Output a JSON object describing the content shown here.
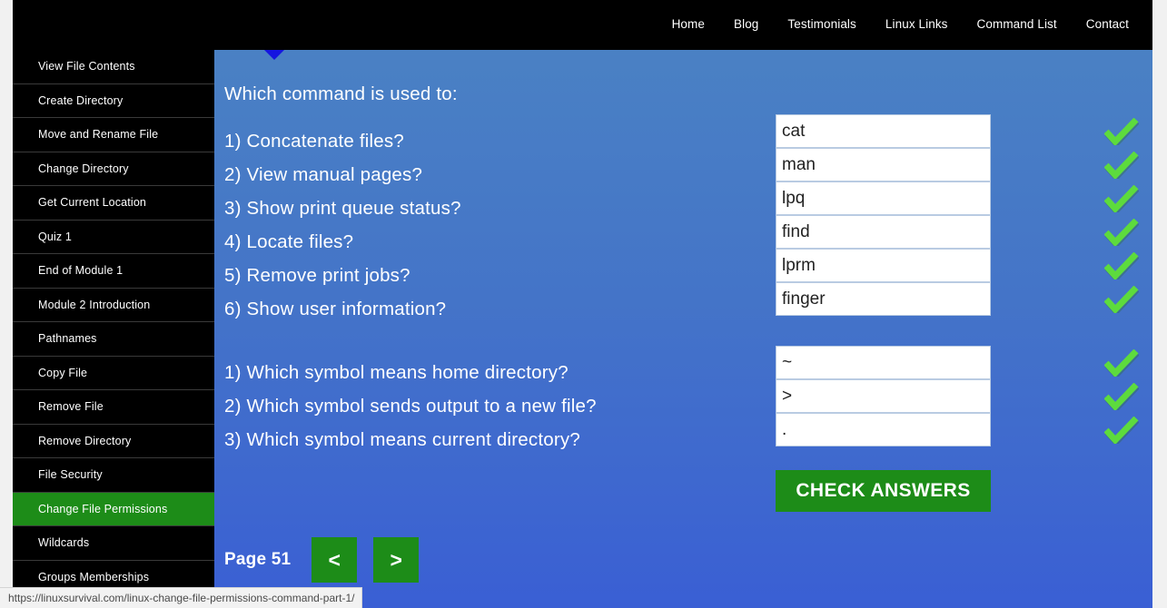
{
  "topnav": {
    "items": [
      {
        "label": "Home"
      },
      {
        "label": "Blog"
      },
      {
        "label": "Testimonials"
      },
      {
        "label": "Linux Links"
      },
      {
        "label": "Command List"
      },
      {
        "label": "Contact"
      }
    ]
  },
  "sidebar": {
    "items": [
      {
        "label": "View File Contents",
        "active": false
      },
      {
        "label": "Create Directory",
        "active": false
      },
      {
        "label": "Move and Rename File",
        "active": false
      },
      {
        "label": "Change Directory",
        "active": false
      },
      {
        "label": "Get Current Location",
        "active": false
      },
      {
        "label": "Quiz 1",
        "active": false
      },
      {
        "label": "End of Module 1",
        "active": false
      },
      {
        "label": "Module 2 Introduction",
        "active": false
      },
      {
        "label": "Pathnames",
        "active": false
      },
      {
        "label": "Copy File",
        "active": false
      },
      {
        "label": "Remove File",
        "active": false
      },
      {
        "label": "Remove Directory",
        "active": false
      },
      {
        "label": "File Security",
        "active": false
      },
      {
        "label": "Change File Permissions",
        "active": true
      },
      {
        "label": "Wildcards",
        "active": false
      },
      {
        "label": "Groups Memberships",
        "active": false
      }
    ]
  },
  "quiz": {
    "heading": "Which command is used to:",
    "group1": {
      "questions": [
        "1) Concatenate files?",
        "2) View manual pages?",
        "3) Show print queue status?",
        "4) Locate files?",
        "5) Remove print jobs?",
        "6) Show user information?"
      ],
      "answers": [
        "cat",
        "man",
        "lpq",
        "find",
        "lprm",
        "finger"
      ],
      "results": [
        "correct",
        "correct",
        "correct",
        "correct",
        "correct",
        "correct"
      ]
    },
    "group2": {
      "questions": [
        "1) Which symbol means home directory?",
        "2) Which symbol sends output to a new file?",
        "3) Which symbol means current directory?"
      ],
      "answers": [
        "~",
        ">",
        "."
      ],
      "results": [
        "correct",
        "correct",
        "correct"
      ]
    },
    "check_button_label": "CHECK ANSWERS",
    "icons": {
      "check": "check-mark-icon",
      "prev": "chevron-left-icon",
      "next": "chevron-right-icon",
      "pointer": "triangle-down-icon"
    }
  },
  "pager": {
    "page_label": "Page 51",
    "prev_label": "<",
    "next_label": ">"
  },
  "statusbar": {
    "url": "https://linuxsurvival.com/linux-change-file-permissions-command-part-1/"
  },
  "colors": {
    "accent_green": "#1d8c18",
    "panel_blue_top": "#4a81c4",
    "panel_blue_bottom": "#3a5fd4",
    "sidebar_black": "#000000",
    "check_green": "#5ddb3d",
    "pointer_blue": "#1515e0"
  }
}
